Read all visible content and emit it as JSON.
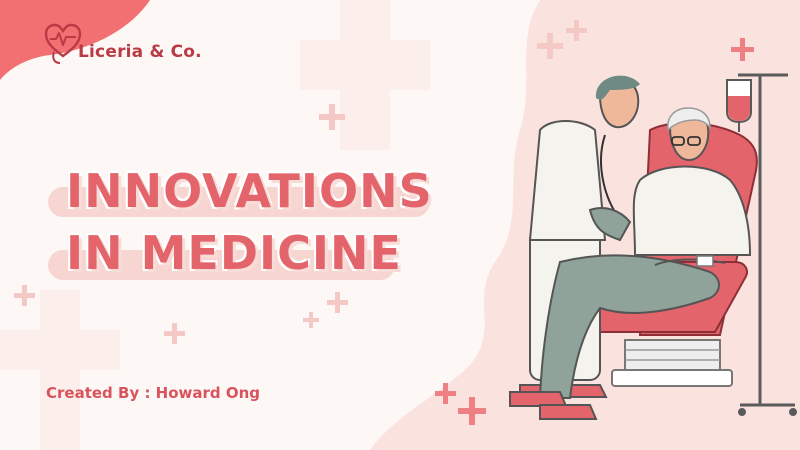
{
  "brand": {
    "name": "Liceria & Co.",
    "logo_icon": "heart-stethoscope-icon"
  },
  "title": {
    "line1": "INNOVATIONS",
    "line2": "IN MEDICINE"
  },
  "credit": {
    "text": "Created By : Howard Ong"
  },
  "illustration": {
    "subject": "nurse-measuring-patient-blood-pressure"
  },
  "colors": {
    "accent": "#e4646c",
    "accent_dark": "#b83b45",
    "blush": "#f8dcd8",
    "background": "#fdf7f5",
    "sage": "#8fa39a"
  }
}
